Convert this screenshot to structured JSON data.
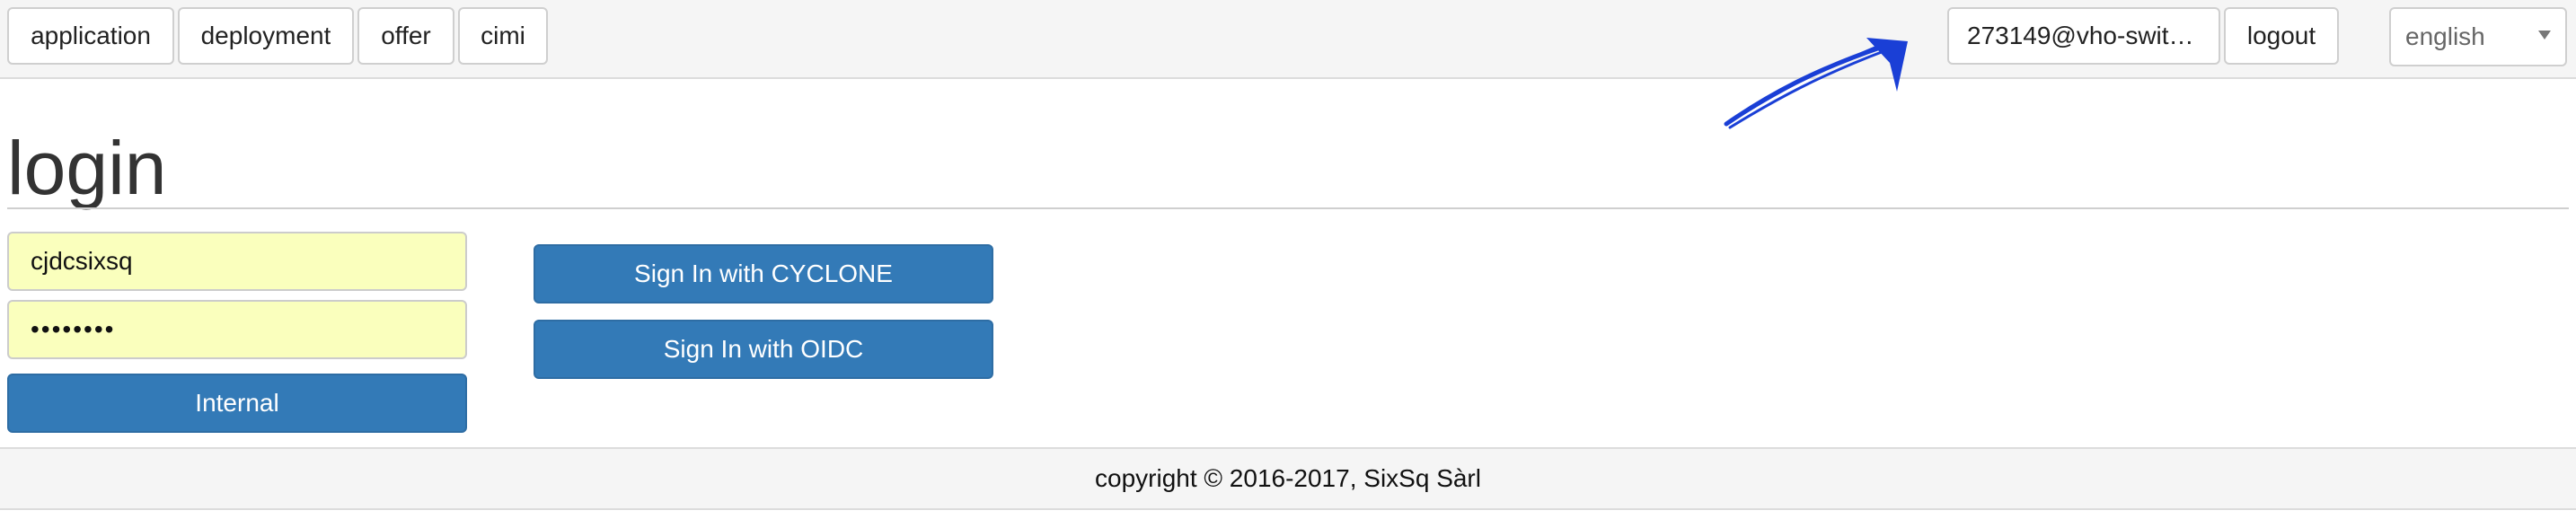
{
  "nav": {
    "items": [
      {
        "label": "application"
      },
      {
        "label": "deployment"
      },
      {
        "label": "offer"
      },
      {
        "label": "cimi"
      }
    ],
    "user_label": "273149@vho-swit…",
    "logout_label": "logout",
    "language": {
      "selected": "english"
    }
  },
  "main": {
    "title": "login",
    "username_value": "cjdcsixsq",
    "password_mask": "••••••••",
    "internal_label": "Internal",
    "cyclone_label": "Sign In with CYCLONE",
    "oidc_label": "Sign In with OIDC"
  },
  "footer": {
    "copyright": "copyright © 2016-2017, SixSq Sàrl"
  },
  "colors": {
    "primary": "#337ab7",
    "autofill": "#faffbd",
    "annotation_arrow": "#1a3fd6"
  },
  "icons": {
    "language_caret": "caret-down-icon",
    "annotation": "arrow-annotation-icon"
  }
}
